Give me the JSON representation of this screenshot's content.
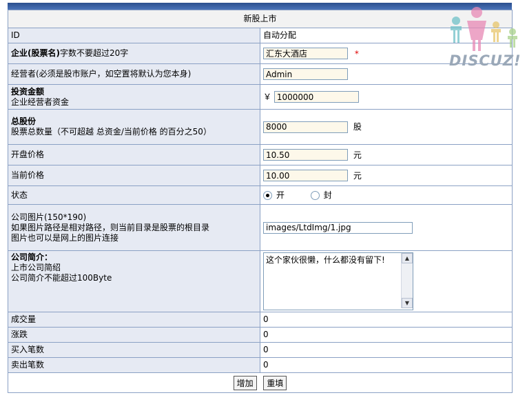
{
  "form": {
    "title": "新股上市",
    "rows": {
      "id": {
        "label": "ID",
        "value": "自动分配"
      },
      "name": {
        "label_bold": "企业(股票名)",
        "label_rest": "字数不要超过20字",
        "value": "汇东大酒店",
        "required_mark": "*"
      },
      "operator": {
        "label": "经营者(必须是股市账户，如空置将默认为您本身)",
        "value": "Admin"
      },
      "capital": {
        "label_bold": "投资金额",
        "sublabel": "企业经营者资金",
        "currency": "￥",
        "value": "1000000"
      },
      "shares": {
        "label_bold": "总股份",
        "sublabel": "股票总数量（不可超越 总资金/当前价格 的百分之50）",
        "value": "8000",
        "unit": "股"
      },
      "open_price": {
        "label": "开盘价格",
        "value": "10.50",
        "unit": "元"
      },
      "current_price": {
        "label": "当前价格",
        "value": "10.00",
        "unit": "元"
      },
      "status": {
        "label": "状态",
        "option_open": "开",
        "option_closed": "封",
        "selected": "开"
      },
      "image": {
        "label_line1": "公司图片(150*190)",
        "label_line2": "如果图片路径是相对路径，则当前目录是股票的根目录",
        "label_line3": "图片也可以是网上的图片连接",
        "value": "images/LtdImg/1.jpg"
      },
      "intro": {
        "label_bold": "公司简介：",
        "sublabel1": "上市公司简绍",
        "sublabel2": "公司简介不能超过100Byte",
        "value": "这个家伙很懒，什么都没有留下!"
      },
      "volume": {
        "label": "成交量",
        "value": "0"
      },
      "change": {
        "label": "涨跌",
        "value": "0"
      },
      "buy_count": {
        "label": "买入笔数",
        "value": "0"
      },
      "sell_count": {
        "label": "卖出笔数",
        "value": "0"
      }
    },
    "buttons": {
      "submit": "增加",
      "reset": "重填"
    }
  },
  "logo": {
    "text": "DISCUZ!"
  }
}
